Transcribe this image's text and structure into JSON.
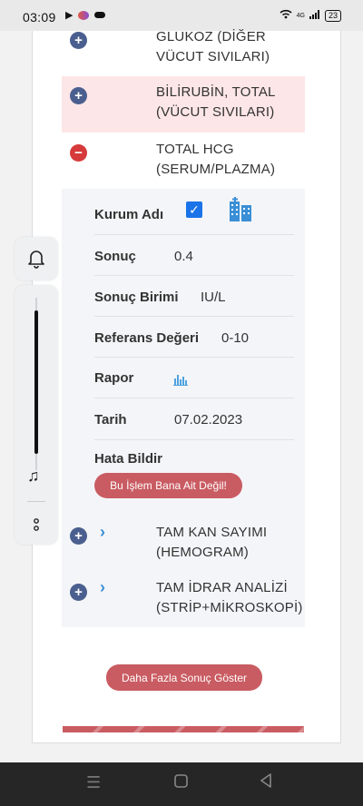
{
  "status_bar": {
    "time": "03:09",
    "network": "4G",
    "battery": "23"
  },
  "results": [
    {
      "title_line1": "GLUKOZ (DİĞER",
      "title_line2": "VÜCUT SIVILARI)",
      "state": "collapsed"
    },
    {
      "title_line1": "BİLİRUBİN, TOTAL",
      "title_line2": "(VÜCUT SIVILARI)",
      "state": "collapsed",
      "highlight": "#fde6e7"
    },
    {
      "title_line1": "TOTAL HCG",
      "title_line2": "(SERUM/PLAZMA)",
      "state": "expanded"
    },
    {
      "title_line1": "TAM KAN SAYIMI",
      "title_line2": "(HEMOGRAM)",
      "state": "collapsed"
    },
    {
      "title_line1": "TAM İDRAR ANALİZİ",
      "title_line2": "(STRİP+MİKROSKOPİ)",
      "state": "collapsed"
    }
  ],
  "detail": {
    "kurum_label": "Kurum Adı",
    "sonuc_label": "Sonuç",
    "sonuc_value": "0.4",
    "birim_label": "Sonuç Birimi",
    "birim_value": "IU/L",
    "referans_label": "Referans Değeri",
    "referans_value": "0-10",
    "rapor_label": "Rapor",
    "tarih_label": "Tarih",
    "tarih_value": "07.02.2023",
    "hata_label": "Hata Bildir",
    "hata_button": "Bu İşlem Bana Ait Değil!"
  },
  "more_button": "Daha Fazla Sonuç Göster",
  "colors": {
    "accent": "#c95c62",
    "plus": "#4a5f8f",
    "minus": "#d63a3a",
    "chevron": "#3a8fd6"
  }
}
